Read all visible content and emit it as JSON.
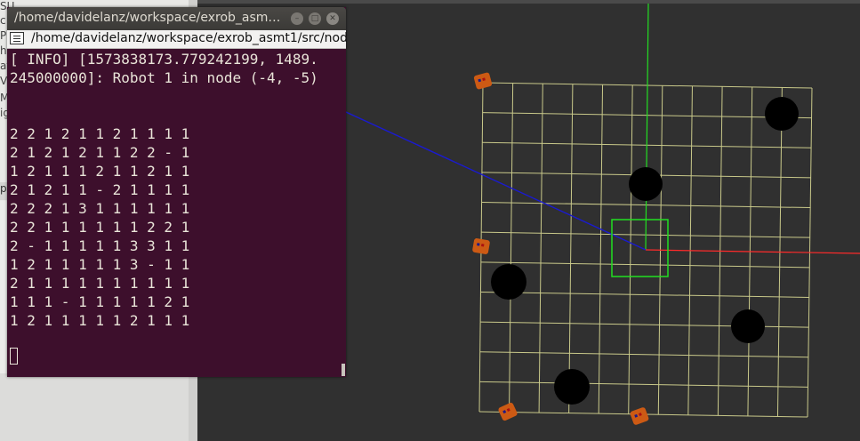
{
  "terminal": {
    "window_title": "/home/davidelanz/workspace/exrob_asm…",
    "tab_label": "/home/davidelanz/workspace/exrob_asmt1/src/nod",
    "log_line_1": "[ INFO] [1573838173.779242199, 1489.",
    "log_line_2": "245000000]: Robot 1 in node (-4, -5)",
    "grid_rows": [
      "2 2 1 2 1 1 2 1 1 1 1",
      "2 1 2 1 2 1 1 2 2 - 1",
      "1 2 1 1 1 2 1 1 2 1 1",
      "2 1 2 1 1 - 2 1 1 1 1",
      "2 2 2 1 3 1 1 1 1 1 1",
      "2 2 1 1 1 1 1 1 2 2 1",
      "2 - 1 1 1 1 1 3 3 1 1",
      "1 2 1 1 1 1 1 3 - 1 1",
      "2 1 1 1 1 1 1 1 1 1 1",
      "1 1 1 - 1 1 1 1 1 2 1",
      "1 2 1 1 1 1 1 2 1 1 1"
    ]
  },
  "rviz_sidebar": {
    "fragments": [
      "SU",
      "c",
      "P",
      "h",
      "at",
      "Vi",
      "Models",
      "ights"
    ],
    "panel_label": "pe"
  },
  "scene": {
    "grid_color": "#c9c98a",
    "x_axis_color": "#ff2a2a",
    "y_axis_color": "#22dd22",
    "link_line_color": "#1a1ad0",
    "node_box_color": "#20e020",
    "obstacle_color": "#000000",
    "robot_color": "#cc5a14"
  }
}
